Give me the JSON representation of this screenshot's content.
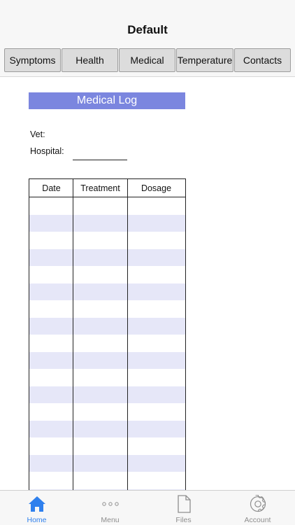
{
  "navbar": {
    "title": "Default"
  },
  "tabs": [
    {
      "label": "Symptoms"
    },
    {
      "label": "Health"
    },
    {
      "label": "Medical"
    },
    {
      "label": "Temperature"
    },
    {
      "label": "Contacts"
    }
  ],
  "log": {
    "title": "Medical Log",
    "vet_label": "Vet:",
    "hospital_label": "Hospital:",
    "columns": [
      "Date",
      "Treatment",
      "Dosage"
    ]
  },
  "tabbar": {
    "items": [
      {
        "label": "Home",
        "icon": "home-icon",
        "active": true
      },
      {
        "label": "Menu",
        "icon": "more-dots-icon",
        "active": false
      },
      {
        "label": "Files",
        "icon": "file-icon",
        "active": false
      },
      {
        "label": "Account",
        "icon": "gear-icon",
        "active": false
      }
    ]
  },
  "colors": {
    "accent": "#2f80ed",
    "log_title_bg": "#7b86df",
    "row_stripe": "#e6e7f8"
  }
}
